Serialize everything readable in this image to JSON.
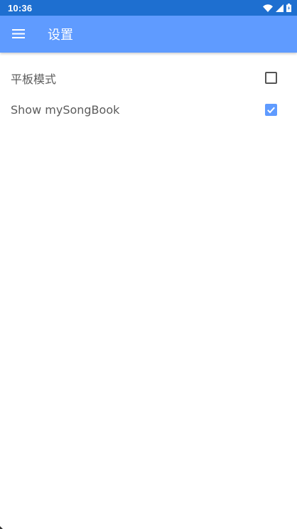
{
  "status_bar": {
    "time": "10:36",
    "icons": [
      "wifi-icon",
      "cell-signal-icon",
      "battery-icon"
    ]
  },
  "app_bar": {
    "menu_icon": "menu-icon",
    "title": "设置"
  },
  "settings": [
    {
      "label": "平板模式",
      "checked": false
    },
    {
      "label": "Show mySongBook",
      "checked": true
    }
  ],
  "colors": {
    "status_bar": "#1e6fd0",
    "app_bar": "#5f9bff",
    "accent": "#5f9bff",
    "label_text": "#5c5c5c"
  }
}
